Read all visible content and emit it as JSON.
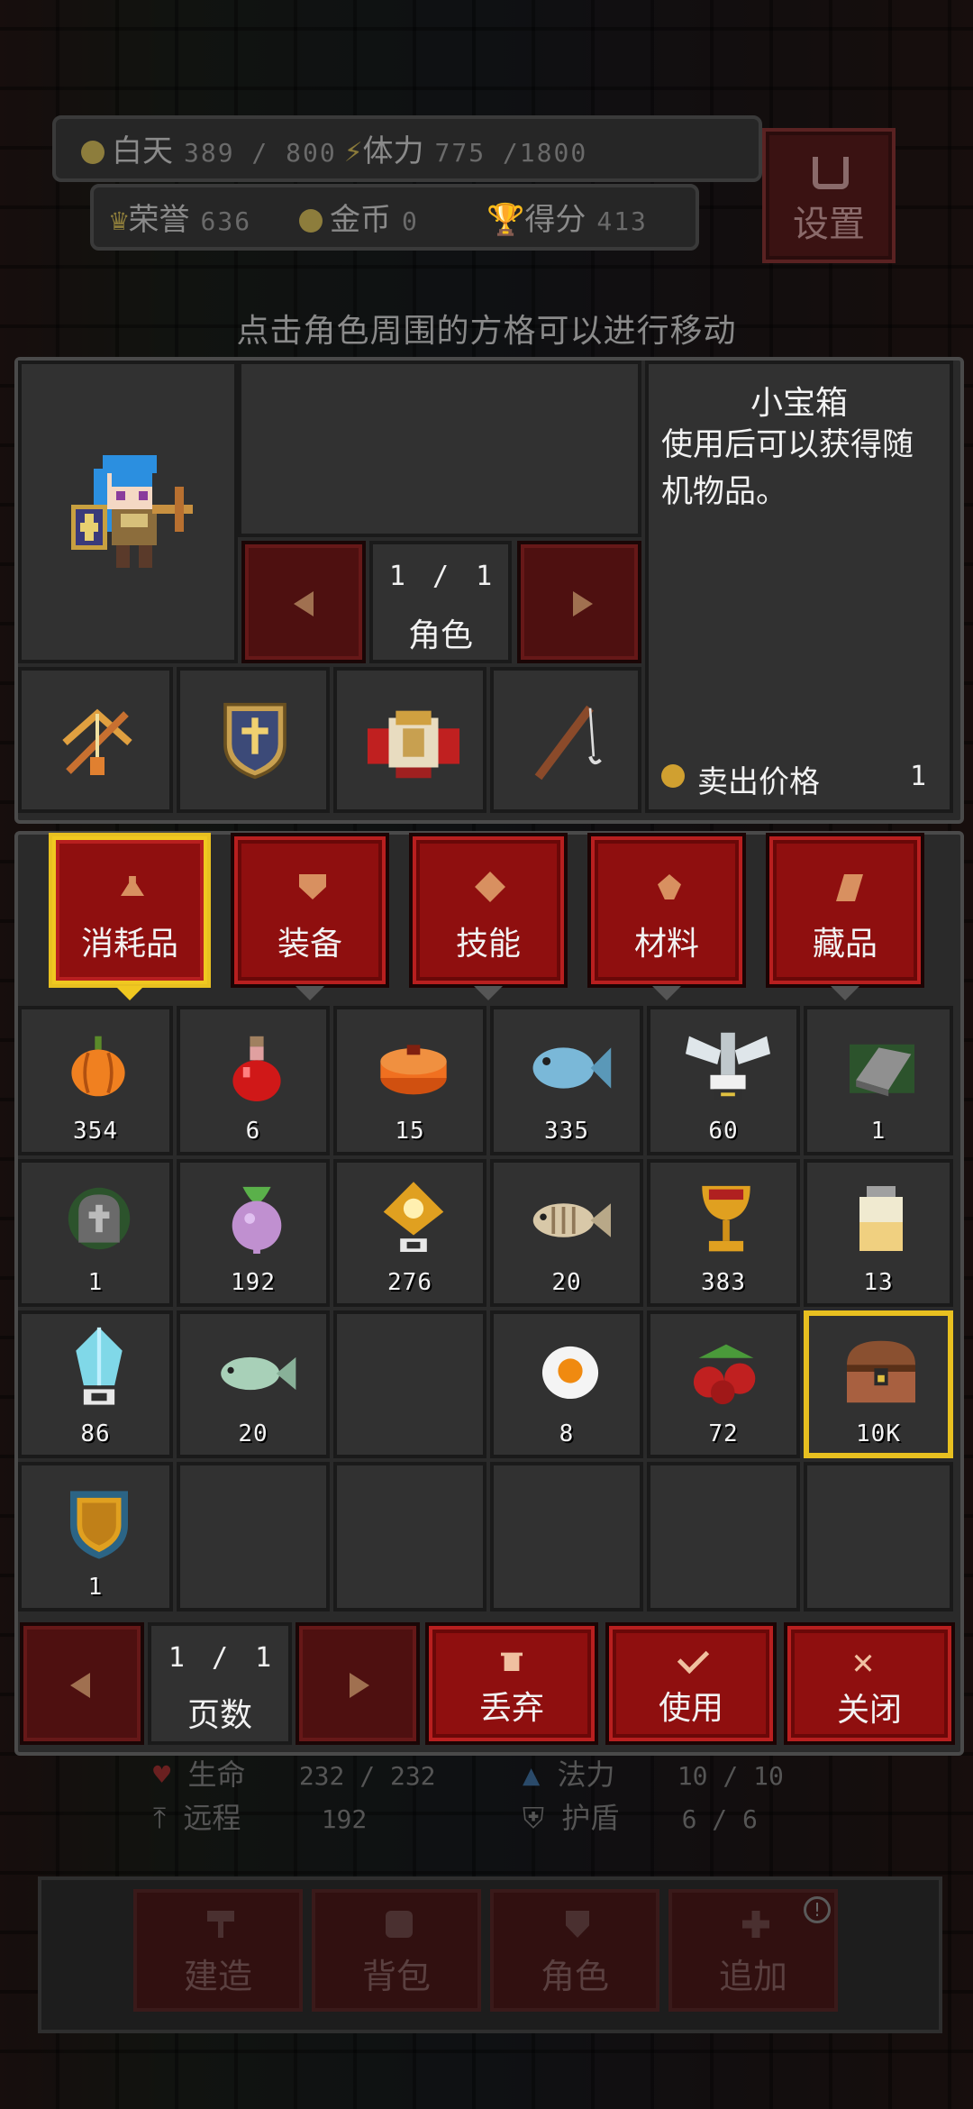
{
  "hud": {
    "day_label": "白天",
    "day_value": "389 / 800",
    "stamina_label": "体力",
    "stamina_value": "775 /1800",
    "honor_label": "荣誉",
    "honor_value": "636",
    "gold_label": "金币",
    "gold_value": "0",
    "score_label": "得分",
    "score_value": "413",
    "settings_label": "设置"
  },
  "hint": "点击角色周围的方格可以进行移动",
  "character": {
    "page_current": "1",
    "page_sep": "/",
    "page_total": "1",
    "page_label": "角色",
    "equipment_icons": [
      "crossbow-icon",
      "shield-icon",
      "armor-icon",
      "fishing-rod-icon"
    ]
  },
  "item_detail": {
    "name": "小宝箱",
    "description": "使用后可以获得随机物品。",
    "sell_label": "卖出价格",
    "sell_price": "1"
  },
  "tabs": [
    {
      "label": "消耗品",
      "icon": "potion-flask-icon",
      "active": true
    },
    {
      "label": "装备",
      "icon": "shield-icon",
      "active": false
    },
    {
      "label": "技能",
      "icon": "diamond-icon",
      "active": false
    },
    {
      "label": "材料",
      "icon": "gem-icon",
      "active": false
    },
    {
      "label": "藏品",
      "icon": "leaf-icon",
      "active": false
    }
  ],
  "items": [
    {
      "icon": "pumpkin-icon",
      "count": "354"
    },
    {
      "icon": "red-potion-icon",
      "count": "6"
    },
    {
      "icon": "cake-icon",
      "count": "15"
    },
    {
      "icon": "blue-fish-icon",
      "count": "335"
    },
    {
      "icon": "winged-statue-icon",
      "count": "60"
    },
    {
      "icon": "iron-ingot-icon",
      "count": "1"
    },
    {
      "icon": "tombstone-icon",
      "count": "1"
    },
    {
      "icon": "turnip-icon",
      "count": "192"
    },
    {
      "icon": "golden-relic-icon",
      "count": "276"
    },
    {
      "icon": "bone-fish-icon",
      "count": "20"
    },
    {
      "icon": "golden-chalice-icon",
      "count": "383"
    },
    {
      "icon": "milk-jar-icon",
      "count": "13"
    },
    {
      "icon": "crystal-icon",
      "count": "86"
    },
    {
      "icon": "green-fish-icon",
      "count": "20"
    },
    {
      "icon": "empty",
      "count": ""
    },
    {
      "icon": "fried-egg-icon",
      "count": "8"
    },
    {
      "icon": "cherries-icon",
      "count": "72"
    },
    {
      "icon": "treasure-chest-icon",
      "count": "10K",
      "selected": true
    },
    {
      "icon": "gold-shield-icon",
      "count": "1"
    }
  ],
  "pager": {
    "current": "1",
    "sep": "/",
    "total": "1",
    "label": "页数"
  },
  "actions": {
    "discard": "丢弃",
    "use": "使用",
    "close": "关闭"
  },
  "stats": {
    "hp_label": "生命",
    "hp_value": "232 / 232",
    "mp_label": "法力",
    "mp_value": "10 / 10",
    "range_label": "远程",
    "range_value": "192",
    "shield_label": "护盾",
    "shield_value": "6  /  6"
  },
  "nav": {
    "build": "建造",
    "bag": "背包",
    "role": "角色",
    "add": "追加",
    "badge": "!"
  }
}
